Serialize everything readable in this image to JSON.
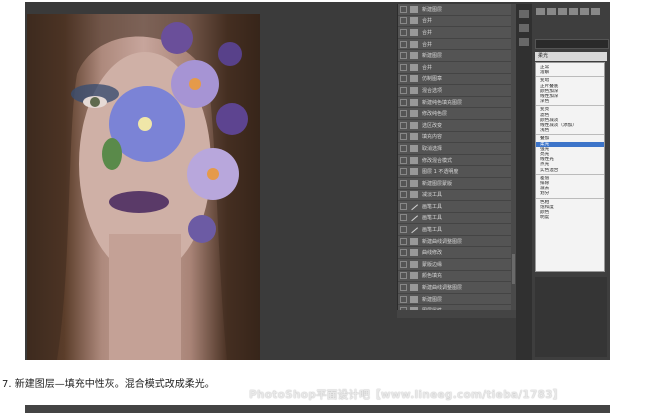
{
  "caption": "7. 新建图层—填充中性灰。混合模式改成柔光。",
  "watermark": "PhotoShop平面设计吧【www.lineeg.com/tieba/1783】",
  "blend_panel": {
    "current_mode": "柔光",
    "modes": [
      [
        "正常",
        "溶解"
      ],
      [
        "变暗",
        "正片叠底",
        "颜色加深",
        "线性加深",
        "深色"
      ],
      [
        "变亮",
        "滤色",
        "颜色减淡",
        "线性减淡（添加）",
        "浅色"
      ],
      [
        "叠加",
        "柔光",
        "强光",
        "亮光",
        "线性光",
        "点光",
        "实色混合"
      ],
      [
        "差值",
        "排除",
        "减去",
        "划分"
      ],
      [
        "色相",
        "饱和度",
        "颜色",
        "明度"
      ]
    ]
  },
  "history": {
    "items": [
      {
        "label": "新建图层",
        "icon": "doc-icon"
      },
      {
        "label": "合并",
        "icon": "doc-icon"
      },
      {
        "label": "合并",
        "icon": "doc-icon"
      },
      {
        "label": "合并",
        "icon": "doc-icon"
      },
      {
        "label": "新建图层",
        "icon": "doc-icon"
      },
      {
        "label": "合并",
        "icon": "doc-icon"
      },
      {
        "label": "仿制图章",
        "icon": "doc-icon"
      },
      {
        "label": "混合选项",
        "icon": "doc-icon"
      },
      {
        "label": "新建纯色填充图层",
        "icon": "doc-icon"
      },
      {
        "label": "修改纯色层",
        "icon": "doc-icon"
      },
      {
        "label": "选区改变",
        "icon": "doc-icon"
      },
      {
        "label": "填充内容",
        "icon": "doc-icon"
      },
      {
        "label": "取消选择",
        "icon": "doc-icon"
      },
      {
        "label": "修改混合模式",
        "icon": "doc-icon"
      },
      {
        "label": "图层 1 不透明度",
        "icon": "doc-icon"
      },
      {
        "label": "新建图层蒙版",
        "icon": "doc-icon"
      },
      {
        "label": "减淡工具",
        "icon": "doc-icon"
      },
      {
        "label": "画笔工具",
        "icon": "brush-icon"
      },
      {
        "label": "画笔工具",
        "icon": "brush-icon"
      },
      {
        "label": "画笔工具",
        "icon": "brush-icon"
      },
      {
        "label": "新建曲线调整图层",
        "icon": "doc-icon"
      },
      {
        "label": "曲线修改",
        "icon": "doc-icon"
      },
      {
        "label": "蒙版边缘",
        "icon": "doc-icon"
      },
      {
        "label": "颜色填充",
        "icon": "doc-icon"
      },
      {
        "label": "新建曲线调整图层",
        "icon": "doc-icon"
      },
      {
        "label": "新建图层",
        "icon": "doc-icon"
      },
      {
        "label": "图层属性",
        "icon": "doc-icon"
      },
      {
        "label": "混合选项",
        "icon": "doc-icon",
        "active": true
      }
    ]
  },
  "colors": {
    "accent": "#3c74c9",
    "active_row": "#5d748e",
    "panel": "#545454"
  }
}
